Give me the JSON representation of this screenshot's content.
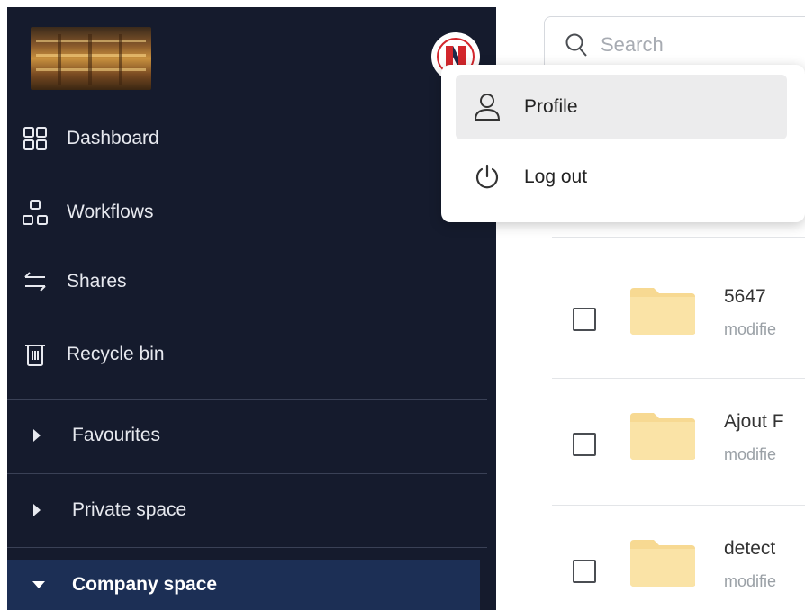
{
  "sidebar": {
    "nav": [
      {
        "label": "Dashboard",
        "icon": "dashboard-grid-icon"
      },
      {
        "label": "Workflows",
        "icon": "workflow-icon"
      },
      {
        "label": "Shares",
        "icon": "share-arrows-icon"
      },
      {
        "label": "Recycle bin",
        "icon": "trash-icon"
      }
    ],
    "sections": [
      {
        "label": "Favourites",
        "expanded": false
      },
      {
        "label": "Private space",
        "expanded": false
      },
      {
        "label": "Company space",
        "expanded": true,
        "active": true
      }
    ],
    "avatar_letter": "N",
    "avatar_color": "#d3262c"
  },
  "search": {
    "placeholder": "Search"
  },
  "menu": {
    "items": [
      {
        "label": "Profile",
        "icon": "user-icon"
      },
      {
        "label": "Log out",
        "icon": "power-icon"
      }
    ]
  },
  "files": [
    {
      "name": "5647",
      "meta": "modifie"
    },
    {
      "name": "Ajout F",
      "meta": "modifie"
    },
    {
      "name": "detect",
      "meta": "modifie"
    }
  ],
  "colors": {
    "sidebar_bg": "#151b2d",
    "active_section_bg": "#1c2f55",
    "folder": "#f7d992"
  }
}
